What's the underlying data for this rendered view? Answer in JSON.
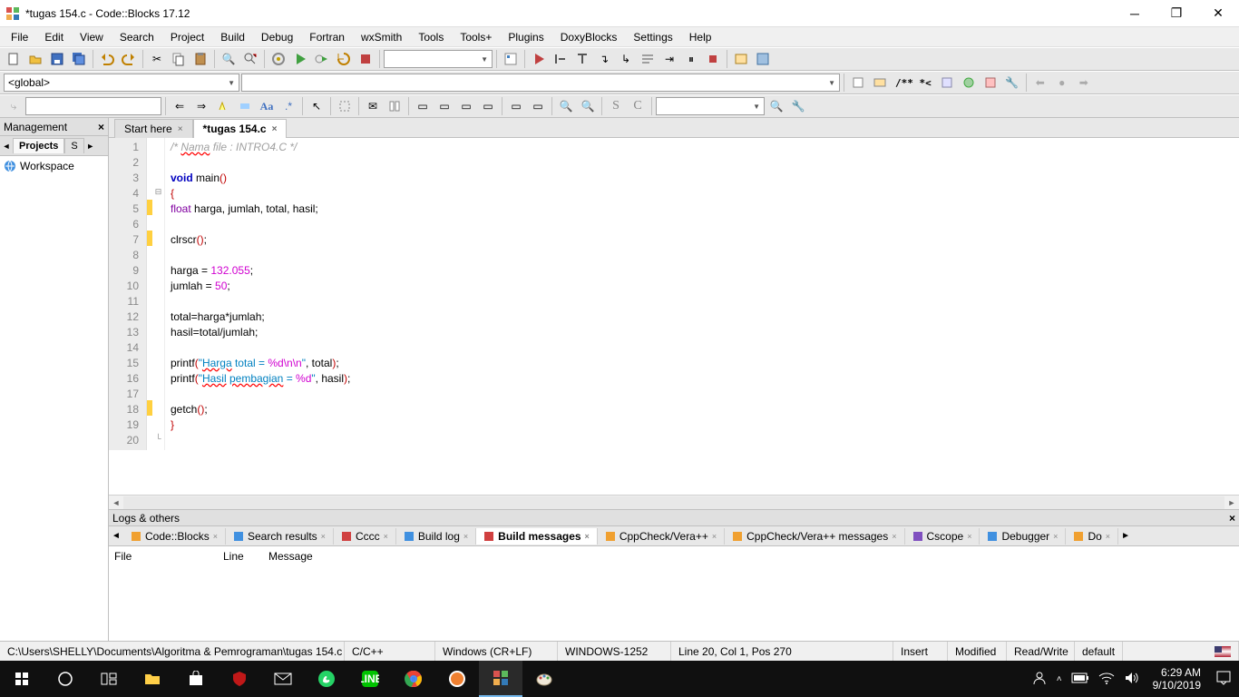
{
  "window": {
    "title": "*tugas 154.c - Code::Blocks 17.12"
  },
  "menu": [
    "File",
    "Edit",
    "View",
    "Search",
    "Project",
    "Build",
    "Debug",
    "Fortran",
    "wxSmith",
    "Tools",
    "Tools+",
    "Plugins",
    "DoxyBlocks",
    "Settings",
    "Help"
  ],
  "scope_dropdown": "<global>",
  "management": {
    "title": "Management",
    "tab_projects": "Projects",
    "tab_s": "S",
    "workspace": "Workspace"
  },
  "tabs": {
    "start": "Start here",
    "active": "*tugas 154.c"
  },
  "code": {
    "lines": [
      {
        "n": 1,
        "html": "<span class='c-comment'>/* <span class='c-wavy'>Nama</span> file : INTRO4.C */</span>"
      },
      {
        "n": 2,
        "html": ""
      },
      {
        "n": 3,
        "html": "<span class='c-keyword'>void</span> main<span class='c-paren'>()</span>"
      },
      {
        "n": 4,
        "html": "<span class='c-brace'>{</span>",
        "fold": "⊟"
      },
      {
        "n": 5,
        "html": "<span class='c-type'>float</span> harga, jumlah, total, hasil;",
        "mark": true
      },
      {
        "n": 6,
        "html": ""
      },
      {
        "n": 7,
        "html": "clrscr<span class='c-paren'>()</span>;",
        "mark": true
      },
      {
        "n": 8,
        "html": ""
      },
      {
        "n": 9,
        "html": "harga = <span class='c-number'>132.055</span>;"
      },
      {
        "n": 10,
        "html": "jumlah = <span class='c-number'>50</span>;"
      },
      {
        "n": 11,
        "html": ""
      },
      {
        "n": 12,
        "html": "total=harga*jumlah;"
      },
      {
        "n": 13,
        "html": "hasil=total/jumlah;"
      },
      {
        "n": 14,
        "html": ""
      },
      {
        "n": 15,
        "html": "printf<span class='c-paren'>(</span><span class='c-string'>\"<span class='c-wavy'>Harga</span> total = <span class='c-fmt'>%d\\n\\n</span>\"</span>, total<span class='c-paren'>)</span>;"
      },
      {
        "n": 16,
        "html": "printf<span class='c-paren'>(</span><span class='c-string'>\"<span class='c-wavy'>Hasil</span> <span class='c-wavy'>pembagian</span> = <span class='c-fmt'>%d</span>\"</span>, hasil<span class='c-paren'>)</span>;"
      },
      {
        "n": 17,
        "html": ""
      },
      {
        "n": 18,
        "html": "getch<span class='c-paren'>()</span>;",
        "mark": true
      },
      {
        "n": 19,
        "html": "<span class='c-brace'>}</span>"
      },
      {
        "n": 20,
        "html": "",
        "fold": "└"
      }
    ]
  },
  "logs": {
    "title": "Logs & others",
    "tabs": [
      "Code::Blocks",
      "Search results",
      "Cccc",
      "Build log",
      "Build messages",
      "CppCheck/Vera++",
      "CppCheck/Vera++ messages",
      "Cscope",
      "Debugger",
      "Do"
    ],
    "active_index": 4,
    "columns": {
      "file": "File",
      "line": "Line",
      "message": "Message"
    }
  },
  "status": {
    "path": "C:\\Users\\SHELLY\\Documents\\Algoritma & Pemrograman\\tugas 154.c",
    "lang": "C/C++",
    "eol": "Windows (CR+LF)",
    "encoding": "WINDOWS-1252",
    "pos": "Line 20, Col 1, Pos 270",
    "insert": "Insert",
    "modified": "Modified",
    "rw": "Read/Write",
    "profile": "default"
  },
  "tray": {
    "time": "6:29 AM",
    "date": "9/10/2019"
  },
  "debug_toolbar_label": "/** *<"
}
